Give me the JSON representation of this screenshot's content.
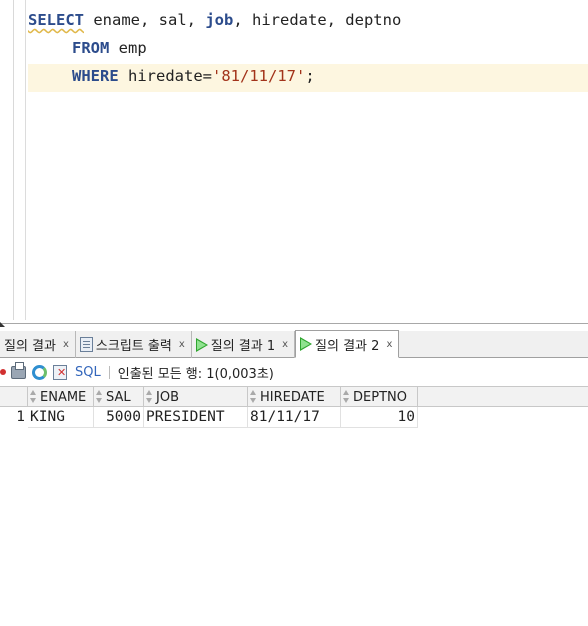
{
  "editor": {
    "line1": {
      "kw_select": "SELECT",
      "rest1": " ename, sal, ",
      "kw_job": "job",
      "rest2": ", hiredate, deptno"
    },
    "line2": {
      "kw_from": "FROM",
      "rest": " emp"
    },
    "line3": {
      "kw_where": "WHERE",
      "rest": " hiredate=",
      "str": "'81/11/17'",
      "end": ";"
    }
  },
  "tabs": [
    {
      "label": "질의 결과",
      "close": "x",
      "icon": "none"
    },
    {
      "label": "스크립트 출력",
      "close": "x",
      "icon": "script-doc-icon"
    },
    {
      "label": "질의 결과 1",
      "close": "x",
      "icon": "run-icon"
    },
    {
      "label": "질의 결과 2",
      "close": "x",
      "icon": "run-icon",
      "active": true
    }
  ],
  "toolbar": {
    "sql_label": "SQL",
    "status_text": "인출된 모든 행: 1(0,003초)"
  },
  "grid": {
    "columns": [
      "ENAME",
      "SAL",
      "JOB",
      "HIREDATE",
      "DEPTNO"
    ],
    "rows": [
      {
        "num": "1",
        "cells": [
          "KING",
          "5000",
          "PRESIDENT",
          "81/11/17",
          "10"
        ]
      }
    ]
  },
  "colors": {
    "keyword": "#2c4c8c",
    "string": "#a2331a",
    "current_line": "#fdf6e0",
    "run_icon": "#2fa52f",
    "sql_link": "#3366bb"
  }
}
